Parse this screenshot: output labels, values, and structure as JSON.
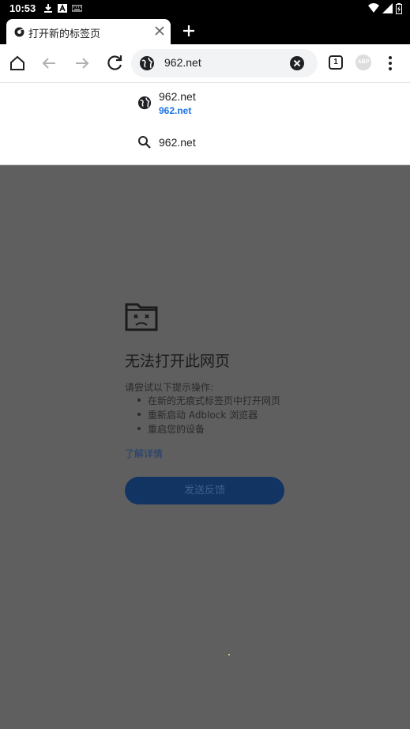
{
  "status": {
    "time": "10:53",
    "left_icons": [
      "download-icon",
      "a-icon",
      "keyboard-icon"
    ],
    "right_icons": [
      "wifi-icon",
      "signal-icon",
      "battery-icon"
    ]
  },
  "tab": {
    "title": "打开新的标签页",
    "favicon": "chrome-icon"
  },
  "toolbar": {
    "url": "962.net",
    "tab_count": "1",
    "abp_label": "ABP"
  },
  "suggestions": [
    {
      "icon": "globe-icon",
      "title": "962.net",
      "url": "962.net"
    },
    {
      "icon": "search-icon",
      "title": "962.net"
    }
  ],
  "error": {
    "heading": "无法打开此网页",
    "suggest_intro": "请尝试以下提示操作:",
    "tips": [
      "在新的无痕式标签页中打开网页",
      "重新启动 Adblock 浏览器",
      "重启您的设备"
    ],
    "learn_more": "了解详情",
    "feedback_button": "发送反馈"
  },
  "colors": {
    "accent": "#1a73e8",
    "dim_overlay": "#5f5f5f",
    "button": "#123463"
  }
}
